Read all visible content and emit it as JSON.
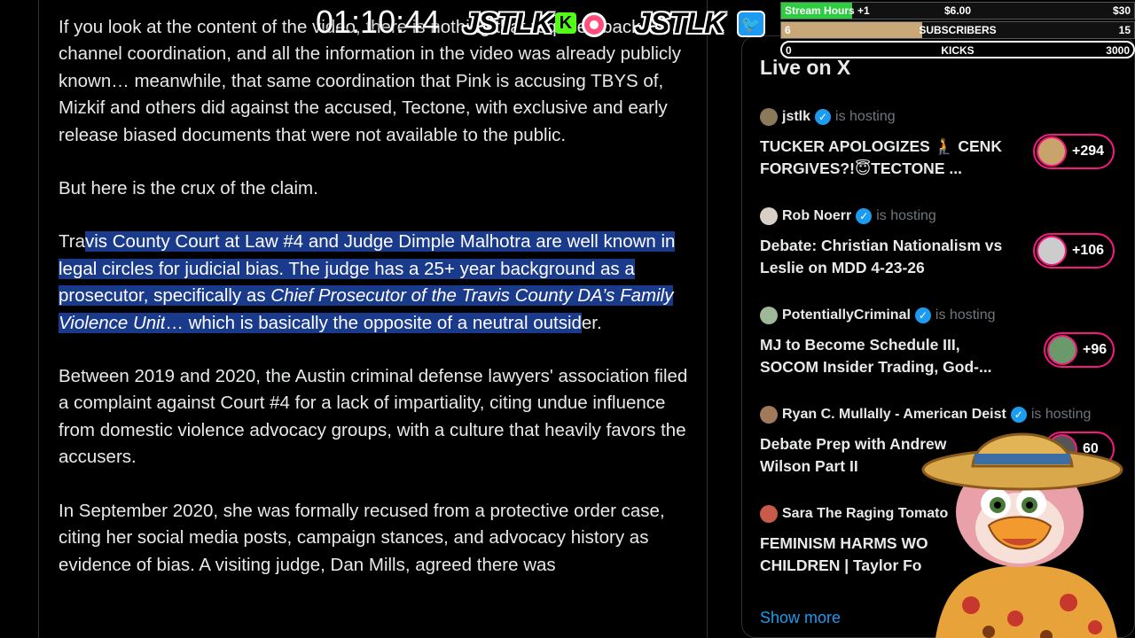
{
  "stream_timer": "01:10:44",
  "branding": {
    "name1": "JSTLK",
    "name2": "JSTLK",
    "kick_glyph": "K"
  },
  "goals": {
    "stream_hours": {
      "label": "Stream Hours",
      "increment": "+1",
      "current": "$6.00",
      "target": "$30",
      "fill_fraction": 0.2,
      "color": "#2ecc40"
    },
    "subscribers": {
      "label": "SUBSCRIBERS",
      "current": "6",
      "target": "15",
      "fill_fraction": 0.4,
      "color": "#c8a878"
    },
    "kicks": {
      "label": "KICKS",
      "current": "0",
      "target": "3000",
      "fill_fraction": 0
    }
  },
  "article": {
    "paragraphs": [
      {
        "id": "p1",
        "text": "If you look at the content of the video, there is nothing that required back-channel coordination, and all the information in the video was already publicly known… meanwhile, that same coordination that Pink is accusing TBYS of, Mizkif and others did against the accused, Tectone, with exclusive and early release biased documents that were not available to the public."
      },
      {
        "id": "p2",
        "text": "But here is the crux of the claim."
      },
      {
        "id": "p3",
        "pre": "Tra",
        "sel1": "vis County Court at Law #4 and Judge Dimple Malhotra are well known in legal circles for judicial bias.  The judge has a 25+ year background as a prosecutor, specifically as ",
        "sel_em": "Chief Prosecutor of the Travis County DA’s Family Violence Unit",
        "sel2": "… which is basically the opposite of a neutral outsid",
        "post": "er."
      },
      {
        "id": "p4",
        "text": "Between 2019 and 2020, the Austin criminal defense lawyers' association filed a complaint against Court #4 for a lack of impartiality, citing undue influence from domestic violence advocacy groups, with a culture that heavily favors the accusers."
      },
      {
        "id": "p5",
        "text": "In September 2020, she was formally recused from a protective order case, citing her social media posts, campaign stances, and advocacy history as evidence of bias. A visiting judge, Dan Mills, agreed there was"
      }
    ]
  },
  "sidebar": {
    "title": "Live on X",
    "hosting_label": "is hosting",
    "items": [
      {
        "host": "jstlk",
        "title": "TUCKER APOLOGIZES 🧎 CENK FORGIVES?!😇TECTONE ...",
        "viewers": "+294"
      },
      {
        "host": "Rob Noerr",
        "title": "Debate: Christian Nationalism vs Leslie on MDD 4-23-26",
        "viewers": "+106"
      },
      {
        "host": "PotentiallyCriminal",
        "title": "MJ to Become Schedule III, SOCOM Insider Trading, God-...",
        "viewers": "+96"
      },
      {
        "host": "Ryan C. Mullally - American Deist",
        "title": "Debate Prep with Andrew Wilson Part II",
        "viewers": "60"
      },
      {
        "host": "Sara The Raging Tomato",
        "title": "FEMINISM HARMS WO CHILDREN |  Taylor Fo",
        "viewers": ""
      }
    ],
    "show_more": "Show more"
  },
  "colors": {
    "selection": "#1a3a8c",
    "accent": "#1d9bf0",
    "live_pill": "#f91880"
  }
}
